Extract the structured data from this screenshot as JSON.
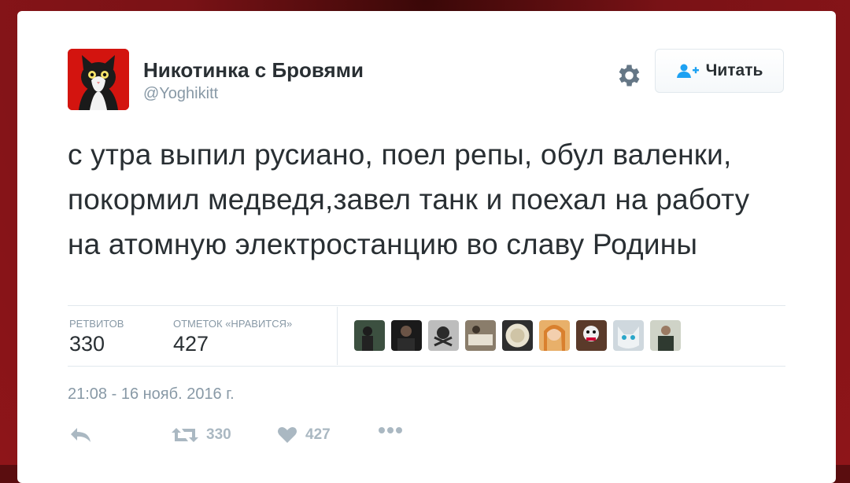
{
  "user": {
    "display_name": "Никотинка с Бровями",
    "handle": "@Yoghikitt"
  },
  "follow_button": {
    "label": "Читать"
  },
  "tweet": {
    "text": "с утра выпил русиано, поел репы, обул валенки, покормил медведя,завел танк и поехал на работу на атомную электростанцию во славу Родины"
  },
  "stats": {
    "retweets_label": "РЕТВИТОВ",
    "retweets_value": "330",
    "likes_label": "ОТМЕТОК «НРАВИТСЯ»",
    "likes_value": "427"
  },
  "likers_count": 9,
  "timestamp": "21:08 - 16 нояб. 2016 г.",
  "actions": {
    "reply_icon": "reply-icon",
    "retweet_icon": "retweet-icon",
    "retweet_count": "330",
    "like_icon": "heart-icon",
    "like_count": "427",
    "more_icon": "more-dots-icon"
  },
  "colors": {
    "background": "#8e1519",
    "text": "#292f33",
    "muted": "#8899a6",
    "follow_icon": "#1da1f2"
  }
}
